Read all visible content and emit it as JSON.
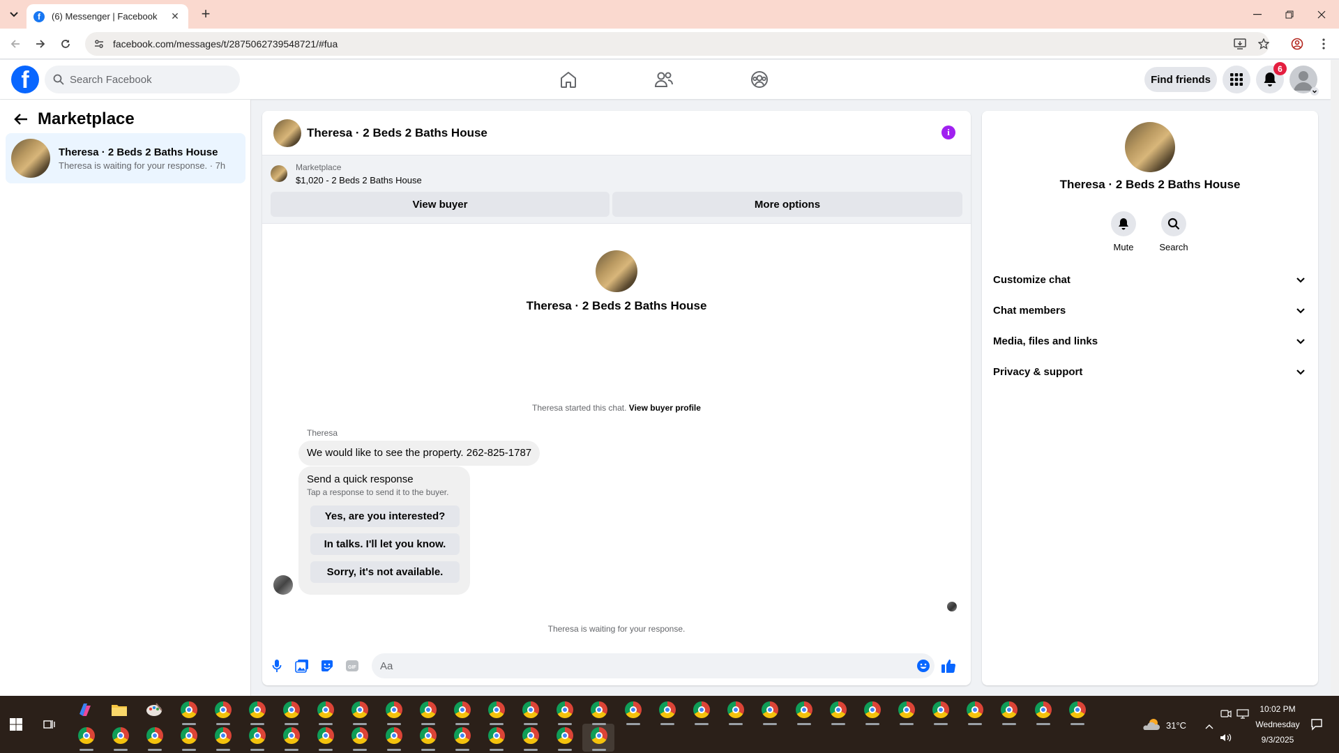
{
  "browser": {
    "tab_title": "(6) Messenger | Facebook",
    "tab_favicon": "f",
    "url": "facebook.com/messages/t/2875062739548721/#fua",
    "new_tab_symbol": "+",
    "close_symbol": "✕"
  },
  "header": {
    "search_placeholder": "Search Facebook",
    "find_friends_label": "Find friends",
    "notification_count": "6",
    "logo_letter": "f"
  },
  "left_panel": {
    "title": "Marketplace",
    "conversations": [
      {
        "name": "Theresa · 2 Beds 2 Baths House",
        "snippet": "Theresa is waiting for your response. · 7h"
      }
    ]
  },
  "chat": {
    "title": "Theresa · 2 Beds 2 Baths House",
    "info_symbol": "i",
    "marketplace_label": "Marketplace",
    "listing": "$1,020 - 2 Beds 2 Baths House",
    "view_buyer_label": "View buyer",
    "more_options_label": "More options",
    "center_name": "Theresa · 2 Beds 2 Baths House",
    "started_text": "Theresa started this chat.",
    "view_profile_link": "View buyer profile",
    "sender_name": "Theresa",
    "message": "We would like to see the property. 262-825-1787",
    "quick_response": {
      "heading": "Send a quick response",
      "subtext": "Tap a response to send it to the buyer.",
      "options": [
        "Yes, are you interested?",
        "In talks. I'll let you know.",
        "Sorry, it's not available."
      ]
    },
    "waiting_text": "Theresa is waiting for your response.",
    "composer_placeholder": "Aa"
  },
  "right_panel": {
    "name": "Theresa · 2 Beds 2 Baths House",
    "mute_label": "Mute",
    "search_label": "Search",
    "sections": [
      "Customize chat",
      "Chat members",
      "Media, files and links",
      "Privacy & support"
    ]
  },
  "taskbar": {
    "weather": "31°C",
    "time": "10:02 PM",
    "day": "Wednesday",
    "date": "9/3/2025"
  },
  "colors": {
    "fb_blue": "#0866ff",
    "tab_bar": "#fad9cf",
    "badge_red": "#e41e3f",
    "info_purple": "#a020f0",
    "taskbar": "#2b2019"
  }
}
